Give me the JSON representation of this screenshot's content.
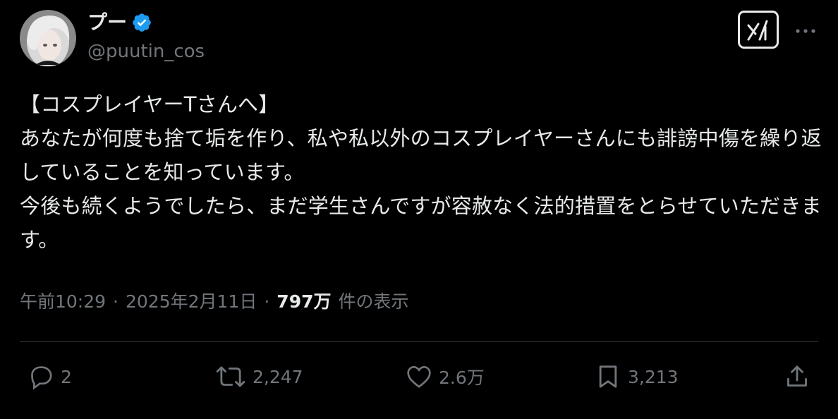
{
  "author": {
    "display_name": "プー",
    "handle": "@puutin_cos",
    "verified": true,
    "verified_color": "#1d9bf0"
  },
  "header_icons": {
    "grok": "grok-icon",
    "more": "more-icon"
  },
  "tweet": {
    "text": "【コスプレイヤーTさんへ】\nあなたが何度も捨て垢を作り、私や私以外のコスプレイヤーさんにも誹謗中傷を繰り返していることを知っています。\n今後も続くようでしたら、まだ学生さんですが容赦なく法的措置をとらせていただきます。"
  },
  "meta": {
    "time": "午前10:29",
    "separator": "·",
    "date": "2025年2月11日",
    "views_count": "797万",
    "views_label": "件の表示"
  },
  "actions": {
    "reply": {
      "icon": "reply-icon",
      "count": "2"
    },
    "repost": {
      "icon": "repost-icon",
      "count": "2,247"
    },
    "like": {
      "icon": "like-icon",
      "count": "2.6万"
    },
    "bookmark": {
      "icon": "bookmark-icon",
      "count": "3,213"
    },
    "share": {
      "icon": "share-icon"
    }
  },
  "colors": {
    "background": "#000000",
    "text": "#e7e9ea",
    "secondary": "#71767b",
    "divider": "#2f3336"
  }
}
